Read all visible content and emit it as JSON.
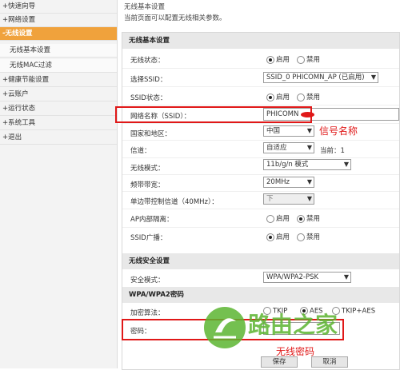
{
  "sidebar": {
    "items": [
      {
        "label": "+快速向导",
        "active": false,
        "sub": false
      },
      {
        "label": "+网络设置",
        "active": false,
        "sub": false
      },
      {
        "label": "-无线设置",
        "active": true,
        "sub": false
      },
      {
        "label": "无线基本设置",
        "active": false,
        "sub": true
      },
      {
        "label": "无线MAC过滤",
        "active": false,
        "sub": true
      },
      {
        "label": "+健康节能设置",
        "active": false,
        "sub": false
      },
      {
        "label": "+云账户",
        "active": false,
        "sub": false
      },
      {
        "label": "+运行状态",
        "active": false,
        "sub": false
      },
      {
        "label": "+系统工具",
        "active": false,
        "sub": false
      },
      {
        "label": "+退出",
        "active": false,
        "sub": false
      }
    ]
  },
  "page": {
    "breadcrumb": "无线基本设置",
    "description": "当前页面可以配置无线相关参数。"
  },
  "basic": {
    "header": "无线基本设置",
    "status_label": "无线状态：",
    "status_on": "启用",
    "status_off": "禁用",
    "ssid_select_label": "选择SSID：",
    "ssid_select_value": "SSID_0 PHICOMN_AP (已启用)",
    "ssid_status_label": "SSID状态：",
    "ssid_status_on": "启用",
    "ssid_status_off": "禁用",
    "ssid_name_label": "网络名称（SSID）：",
    "ssid_name_value": "PHICOMN",
    "country_label": "国家和地区：",
    "country_value": "中国",
    "channel_label": "信道：",
    "channel_value": "自适应",
    "current_channel": "当前：1",
    "mode_label": "无线模式：",
    "mode_value": "11b/g/n 模式",
    "bandwidth_label": "频带带宽：",
    "bandwidth_value": "20MHz",
    "sideband_label": "单边带控制信道（40MHz）：",
    "sideband_value": "下",
    "ap_isolation_label": "AP内部隔离：",
    "ap_isolation_on": "启用",
    "ap_isolation_off": "禁用",
    "ssid_broadcast_label": "SSID广播：",
    "ssid_broadcast_on": "启用",
    "ssid_broadcast_off": "禁用"
  },
  "security": {
    "header": "无线安全设置",
    "mode_label": "安全模式：",
    "mode_value": "WPA/WPA2-PSK",
    "wpa_header": "WPA/WPA2密码",
    "algo_label": "加密算法：",
    "algo_options": [
      "TKIP",
      "AES",
      "TKIP+AES"
    ],
    "password_label": "密码："
  },
  "annotations": {
    "ssid_note": "信号名称",
    "password_note": "无线密码"
  },
  "buttons": {
    "save": "保存",
    "cancel": "取消"
  },
  "watermark": {
    "text": "路由之家"
  },
  "colors": {
    "accent": "#f0a23c",
    "annotation": "#e01818",
    "watermark_green": "#5cb531"
  }
}
